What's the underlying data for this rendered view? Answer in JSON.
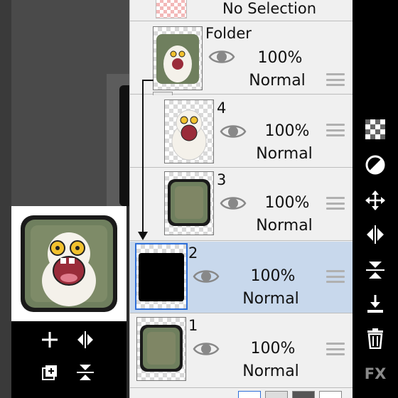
{
  "selection": {
    "label": "No Selection"
  },
  "layers": [
    {
      "name": "Folder",
      "opacity": "100%",
      "blend": "Normal"
    },
    {
      "name": "4",
      "opacity": "100%",
      "blend": "Normal"
    },
    {
      "name": "3",
      "opacity": "100%",
      "blend": "Normal"
    },
    {
      "name": "2",
      "opacity": "100%",
      "blend": "Normal",
      "selected": true
    },
    {
      "name": "1",
      "opacity": "100%",
      "blend": "Normal"
    }
  ],
  "toolbar": {
    "fx_label": "FX"
  },
  "colors": {
    "accent": "#2e6fd8",
    "selected_row": "#c8d8ec",
    "panel_bg": "#f0f0f0"
  }
}
